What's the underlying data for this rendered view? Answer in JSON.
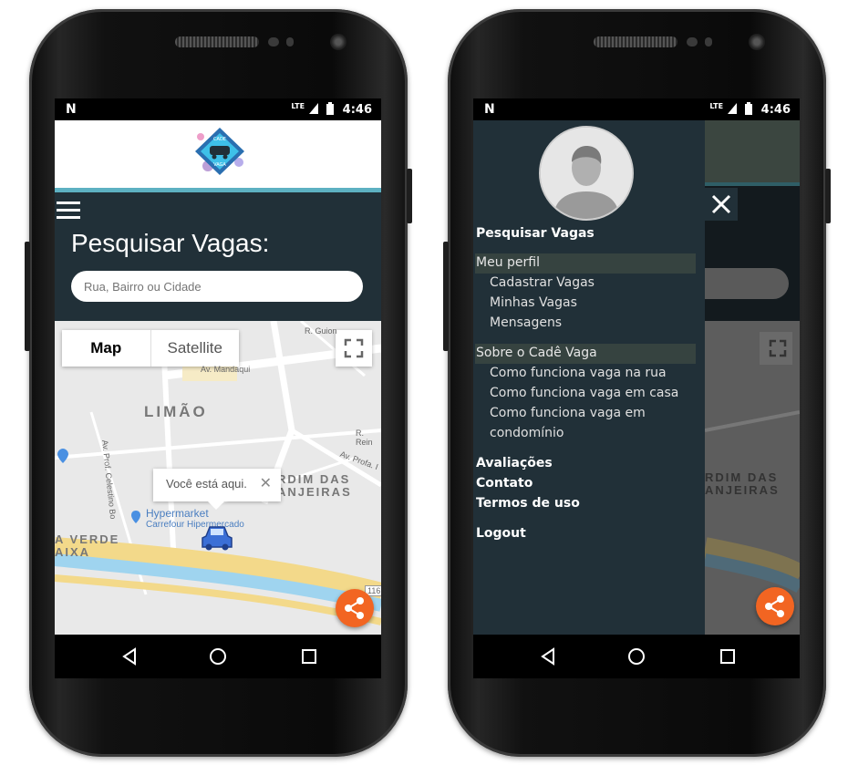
{
  "status": {
    "network": "LTE",
    "time": "4:46",
    "notification_icon": "N"
  },
  "header": {
    "logo_alt": "CADE VAGA"
  },
  "search_section": {
    "title": "Pesquisar Vagas:",
    "placeholder": "Rua, Bairro ou Cidade"
  },
  "map": {
    "type_map": "Map",
    "type_satellite": "Satellite",
    "marker_popup": "Você está aqui.",
    "labels": {
      "r_guion": "R. Guion",
      "av_mandaqui": "Av. Mandaqui",
      "limao": "LIMÃO",
      "celestino": "Av. Prof. Celestino Bo",
      "r_rein": "R. Rein",
      "av_profa": "Av. Profa. I",
      "jardim_1": "RDIM DAS",
      "jardim_2": "ANJEIRAS",
      "hypermarket": "Hypermarket",
      "carrefour": "Carrefour Hipermercado",
      "verde": "A VERDE",
      "baixa": "AIXA",
      "route": "116"
    }
  },
  "drawer": {
    "search": "Pesquisar Vagas",
    "profile_header": "Meu perfil",
    "profile_items": [
      "Cadastrar Vagas",
      "Minhas Vagas",
      "Mensagens"
    ],
    "about_header": "Sobre o Cadê Vaga",
    "about_items": [
      "Como funciona vaga na rua",
      "Como funciona vaga em casa",
      "Como funciona vaga em",
      "condomínio"
    ],
    "reviews": "Avaliações",
    "contact": "Contato",
    "terms": "Termos de uso",
    "logout": "Logout"
  },
  "colors": {
    "dark": "#213038",
    "accent": "#5db1c2",
    "fab": "#f26522"
  }
}
